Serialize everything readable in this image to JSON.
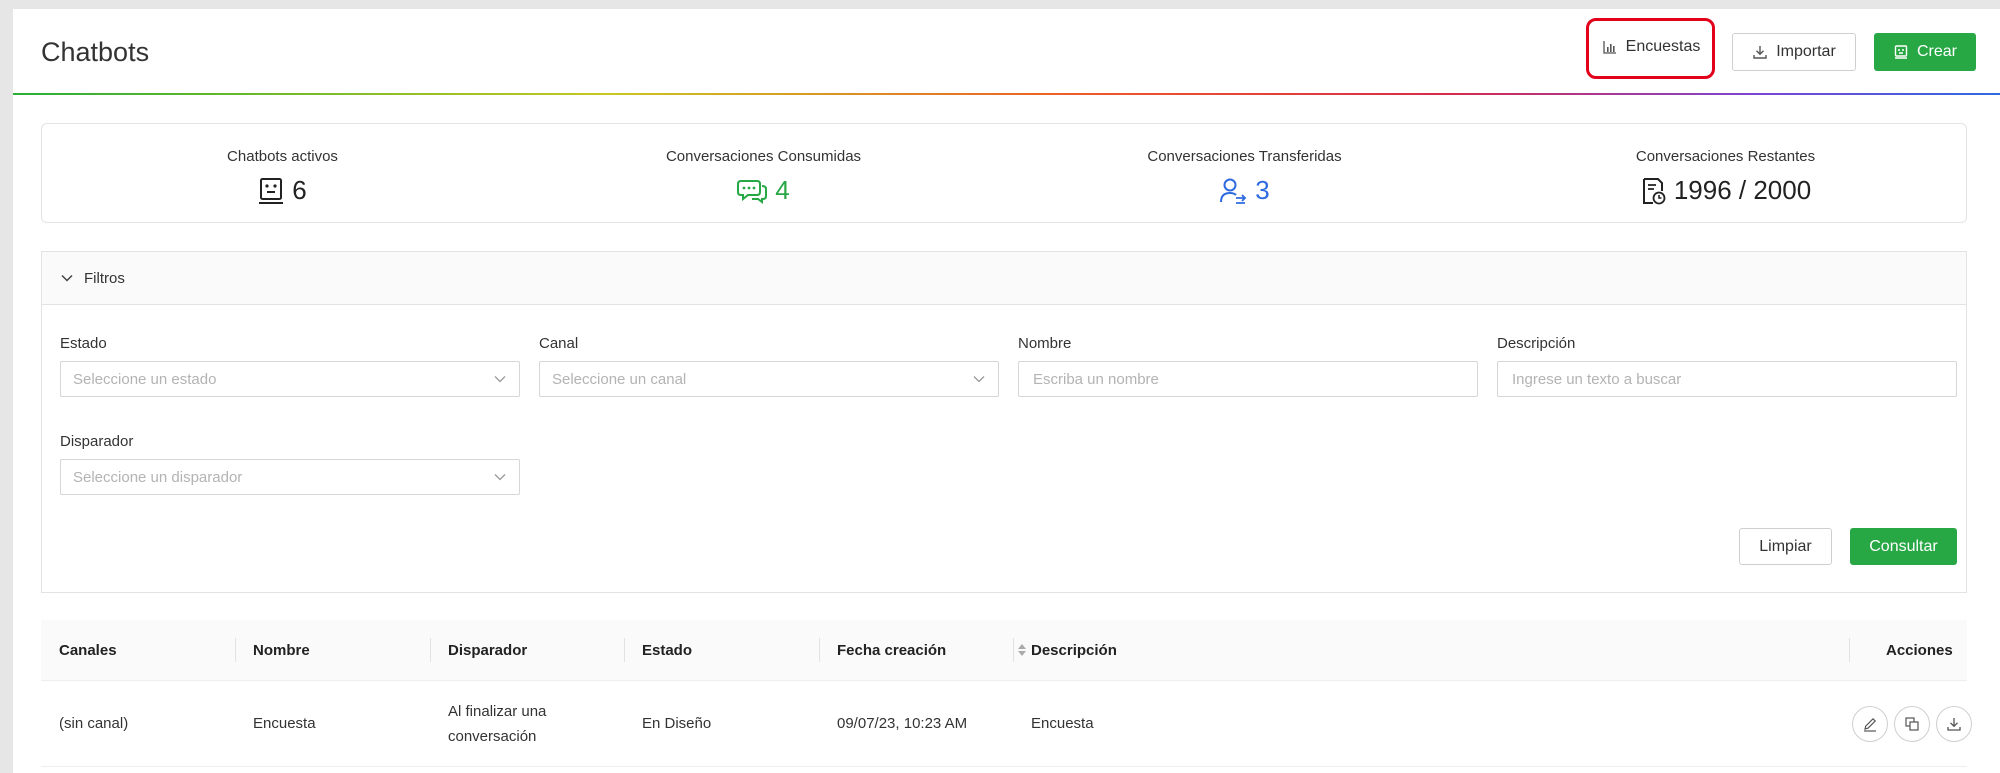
{
  "header": {
    "title": "Chatbots",
    "buttons": {
      "surveys": "Encuestas",
      "import": "Importar",
      "create": "Crear"
    }
  },
  "stats": [
    {
      "label": "Chatbots activos",
      "value": "6",
      "icon": "robot-icon",
      "color": "#222222"
    },
    {
      "label": "Conversaciones Consumidas",
      "value": "4",
      "icon": "chat-bubbles-icon",
      "color": "#28a745"
    },
    {
      "label": "Conversaciones Transferidas",
      "value": "3",
      "icon": "user-transfer-icon",
      "color": "#2f6be0"
    },
    {
      "label": "Conversaciones Restantes",
      "value": "1996 / 2000",
      "icon": "document-clock-icon",
      "color": "#222222"
    }
  ],
  "filters": {
    "title": "Filtros",
    "estado": {
      "label": "Estado",
      "placeholder": "Seleccione un estado"
    },
    "canal": {
      "label": "Canal",
      "placeholder": "Seleccione un canal"
    },
    "nombre": {
      "label": "Nombre",
      "placeholder": "Escriba un nombre"
    },
    "descripcion": {
      "label": "Descripción",
      "placeholder": "Ingrese un texto a buscar"
    },
    "disparador": {
      "label": "Disparador",
      "placeholder": "Seleccione un disparador"
    },
    "clear_label": "Limpiar",
    "submit_label": "Consultar"
  },
  "table": {
    "columns": [
      "Canales",
      "Nombre",
      "Disparador",
      "Estado",
      "Fecha creación",
      "Descripción",
      "Acciones"
    ],
    "rows": [
      {
        "canales": "(sin canal)",
        "nombre": "Encuesta",
        "disparador_l1": "Al finalizar una",
        "disparador_l2": "conversación",
        "estado": "En Diseño",
        "fecha": "09/07/23, 10:23 AM",
        "descripcion": "Encuesta"
      }
    ]
  },
  "colors": {
    "primary_green": "#28a745",
    "highlight_red": "#e3001b",
    "accent_blue": "#2f6be0"
  }
}
